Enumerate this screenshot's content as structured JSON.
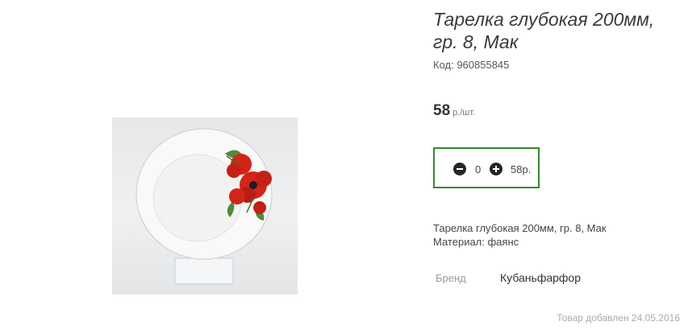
{
  "product": {
    "title": "Тарелка глубокая 200мм, гр. 8, Мак",
    "code": "Код: 960855845",
    "price_value": "58",
    "price_unit": "р./шт.",
    "image_icon": "plate-with-poppies"
  },
  "cart_widget": {
    "quantity": "0",
    "sum": "58р.",
    "accent_color": "#2e8b2e"
  },
  "description": {
    "line1": "Тарелка глубокая 200мм, гр. 8, Мак",
    "line2": "Материал: фаянс"
  },
  "brand": {
    "label": "Бренд",
    "value": "Кубаньфарфор"
  },
  "added_date": "Товар добавлен 24.05.2016"
}
